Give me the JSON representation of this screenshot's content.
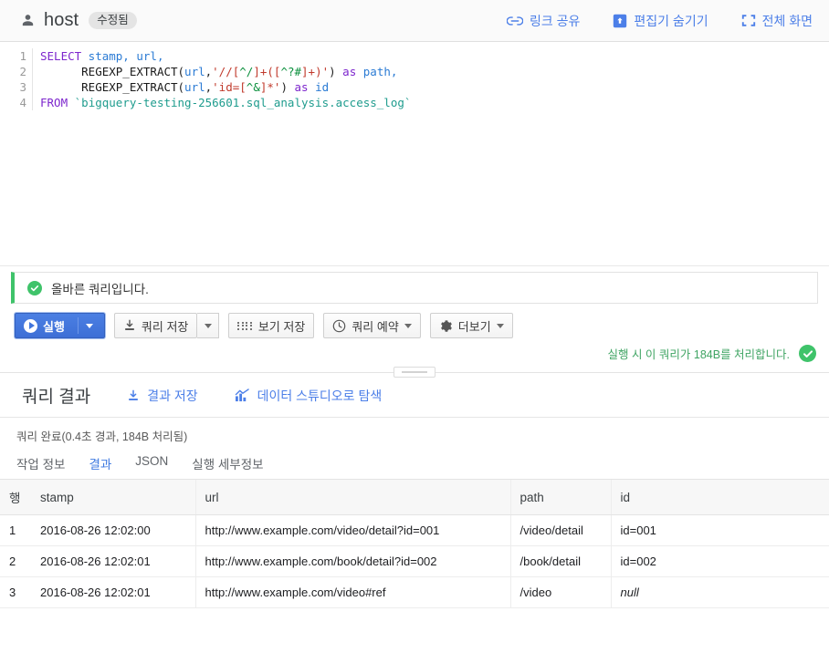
{
  "header": {
    "person_icon": "person-icon",
    "title": "host",
    "badge": "수정됨",
    "actions": [
      {
        "icon": "link-icon",
        "label": "링크 공유"
      },
      {
        "icon": "hide-editor-icon",
        "label": "편집기 숨기기"
      },
      {
        "icon": "fullscreen-icon",
        "label": "전체 화면"
      }
    ]
  },
  "editor": {
    "line_numbers": [
      "1",
      "2",
      "3",
      "4"
    ],
    "sql": {
      "l1_kw": "SELECT",
      "l1_cols": " stamp, url,",
      "l2_fn": "REGEXP_EXTRACT",
      "l2_arg": "url",
      "l2_regex_open": "'//[",
      "l2_regex_br1": "^/",
      "l2_regex_mid": "]+([",
      "l2_regex_br2": "^?#",
      "l2_regex_close": "]+)'",
      "l2_as": " as ",
      "l2_alias": "path,",
      "l3_fn": "REGEXP_EXTRACT",
      "l3_arg": "url",
      "l3_regex_open": "'id=[",
      "l3_regex_br": "^&",
      "l3_regex_close": "]*'",
      "l3_as": " as ",
      "l3_alias": "id",
      "l4_kw": "FROM",
      "l4_table": "`bigquery-testing-256601.sql_analysis.access_log`"
    }
  },
  "validation": {
    "icon": "check-circle-icon",
    "message": "올바른 쿼리입니다."
  },
  "toolbar": {
    "run_label": "실행",
    "run_dropdown": "chevron-down-icon",
    "save_query_label": "쿼리 저장",
    "save_query_icon": "download-icon",
    "save_query_dropdown": "chevron-down-icon",
    "save_view_label": "보기 저장",
    "save_view_icon": "grid-dots-icon",
    "schedule_label": "쿼리 예약",
    "schedule_icon": "clock-icon",
    "more_label": "더보기",
    "more_icon": "gear-icon",
    "cost_text": "실행 시 이 쿼리가 184B를 처리합니다.",
    "cost_icon": "check-circle-icon"
  },
  "results": {
    "title": "쿼리 결과",
    "actions": [
      {
        "icon": "download-icon",
        "label": "결과 저장"
      },
      {
        "icon": "chart-icon",
        "label": "데이터 스튜디오로 탐색"
      }
    ],
    "status": "쿼리 완료(0.4초 경과, 184B 처리됨)",
    "tabs": [
      {
        "label": "작업 정보",
        "active": false
      },
      {
        "label": "결과",
        "active": true
      },
      {
        "label": "JSON",
        "active": false
      },
      {
        "label": "실행 세부정보",
        "active": false
      }
    ],
    "columns": [
      "행",
      "stamp",
      "url",
      "path",
      "id"
    ],
    "rows": [
      {
        "row": "1",
        "stamp": "2016-08-26 12:02:00",
        "url": "http://www.example.com/video/detail?id=001",
        "path": "/video/detail",
        "id": "id=001",
        "id_null": false
      },
      {
        "row": "2",
        "stamp": "2016-08-26 12:02:01",
        "url": "http://www.example.com/book/detail?id=002",
        "path": "/book/detail",
        "id": "id=002",
        "id_null": false
      },
      {
        "row": "3",
        "stamp": "2016-08-26 12:02:01",
        "url": "http://www.example.com/video#ref",
        "path": "/video",
        "id": "null",
        "id_null": true
      }
    ]
  },
  "colors": {
    "accent_blue": "#4c7fe8",
    "success_green": "#3fc36a",
    "primary_button": "#4075dd"
  }
}
